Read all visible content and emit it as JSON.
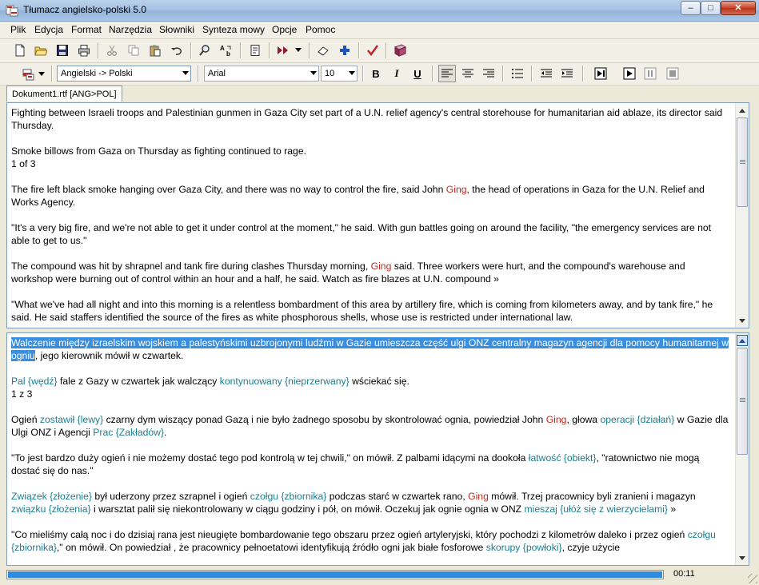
{
  "window": {
    "title": "Tłumacz angielsko-polski 5.0",
    "controls": {
      "minimize": "–",
      "maximize": "□",
      "close": "✕"
    }
  },
  "menu": [
    "Plik",
    "Edycja",
    "Format",
    "Narzędzia",
    "Słowniki",
    "Synteza mowy",
    "Opcje",
    "Pomoc"
  ],
  "toolbar1": {
    "icons": [
      "new-document-icon",
      "open-folder-icon",
      "save-icon",
      "print-icon",
      "cut-icon",
      "copy-icon",
      "paste-icon",
      "undo-icon",
      "find-icon",
      "replace-icon",
      "dictionary-lookup-icon",
      "translate-icon",
      "translate-dropdown-icon",
      "eraser-icon",
      "add-icon",
      "check-icon",
      "book-icon"
    ]
  },
  "toolbar2": {
    "direction_select": "Angielski -> Polski",
    "font_select": "Arial",
    "size_select": "10",
    "bold": "B",
    "italic": "I",
    "underline": "U",
    "icons": [
      "align-left-icon",
      "align-center-icon",
      "align-right-icon",
      "bullets-icon",
      "outdent-icon",
      "indent-icon",
      "play-from-start-icon",
      "play-icon",
      "pause-icon",
      "stop-icon"
    ],
    "align_left_active": true
  },
  "tab": {
    "label": "Dokument1.rtf [ANG>POL]"
  },
  "source_text": {
    "p1": "Fighting between Israeli troops and Palestinian gunmen in Gaza City set part of a U.N. relief agency's central storehouse for humanitarian aid ablaze, its director said Thursday.",
    "p2a": "Smoke billows from Gaza on Thursday as fighting continued to rage.",
    "p2b": "1 of 3",
    "p3a": "The fire left black smoke hanging over Gaza City, and there was no way to control the fire, said John ",
    "p3name": "Ging",
    "p3b": ", the head of operations in Gaza for the U.N. Relief and Works Agency.",
    "p4": "\"It's a very big fire, and we're not able to get it under control at the moment,\" he said. With gun battles going on around the facility, \"the emergency services are not able to get to us.\"",
    "p5a": "The compound was hit by shrapnel and tank fire during clashes Thursday morning, ",
    "p5name": "Ging",
    "p5b": " said. Three workers were hurt, and the compound's warehouse and workshop were burning out of control within an hour and a half, he said.  Watch as fire blazes at U.N. compound »",
    "p6": "\"What we've had all night and into this morning is a relentless bombardment of this area by artillery fire, which is coming from kilometers away, and by tank fire,\" he said. He said staffers identified the source of the fires as white phosphorous shells, whose use is restricted under international law."
  },
  "translation_text": {
    "p1hl": "Walczenie między izraelskim wojskiem a palestyńskimi uzbrojonymi ludźmi w Gazie umieszcza część ulgi ONZ centralny magazyn agencji dla pomocy humanitarnej w ogniu",
    "p1rest": ", jego kierownik mówił w czwartek.",
    "p2t1": "Pal {wędź}",
    "p2a": " fale z Gazy w czwartek jak walczący ",
    "p2t2": "kontynuowany {nieprzerwany}",
    "p2b": " wściekać się.",
    "p2c": "1 z 3",
    "p3a": "Ogień ",
    "p3t1": "zostawił {lewy}",
    "p3b": " czarny dym wiszący ponad Gazą i nie było żadnego sposobu by skontrolować ognia, powiedział John ",
    "p3name": "Ging",
    "p3c": ", głowa ",
    "p3t2": "operacji {działań}",
    "p3d": " w Gazie dla Ulgi ONZ i Agencji ",
    "p3t3": "Prac {Zakładów}",
    "p3e": ".",
    "p4a": "\"To  jest bardzo duży ogień i nie możemy dostać tego pod kontrolą w tej chwili,\" on mówił. Z palbami idącymi na dookoła ",
    "p4t1": "łatwość {obiekt}",
    "p4b": ", \"ratownictwo nie mogą dostać się do nas.\"",
    "p5t1": "Związek {złożenie}",
    "p5a": " był uderzony przez szrapnel i ogień ",
    "p5t2": "czołgu {zbiornika}",
    "p5b": " podczas starć w czwartek rano, ",
    "p5name": "Ging",
    "p5c": " mówił. Trzej pracownicy byli zranieni i magazyn ",
    "p5t3": "związku {złożenia}",
    "p5d": " i warsztat palił się niekontrolowany w ciągu godziny i pół, on mówił.  Oczekuj jak ognie ognia w ONZ ",
    "p5t4": "mieszaj {ułóż się z wierzycielami}",
    "p5e": " »",
    "p6a": "\"Co mieliśmy całą noc i do dzisiaj rana jest nieugięte bombardowanie tego obszaru przez ogień artyleryjski, który pochodzi z kilometrów daleko i przez ogień ",
    "p6t1": "czołgu {zbiornika}",
    "p6b": ",\" on mówił. On powiedział , że pracownicy pełnoetatowi identyfikują źródło ogni jak białe fosforowe ",
    "p6t2": "skorupy {powłoki}",
    "p6c": ", czyje użycie"
  },
  "status": {
    "progress": 1.0,
    "time": "00:11"
  },
  "colors": {
    "unknown_word": "#c0281e",
    "alternative": "#1a7d8f",
    "selection": "#3a8ee0"
  }
}
